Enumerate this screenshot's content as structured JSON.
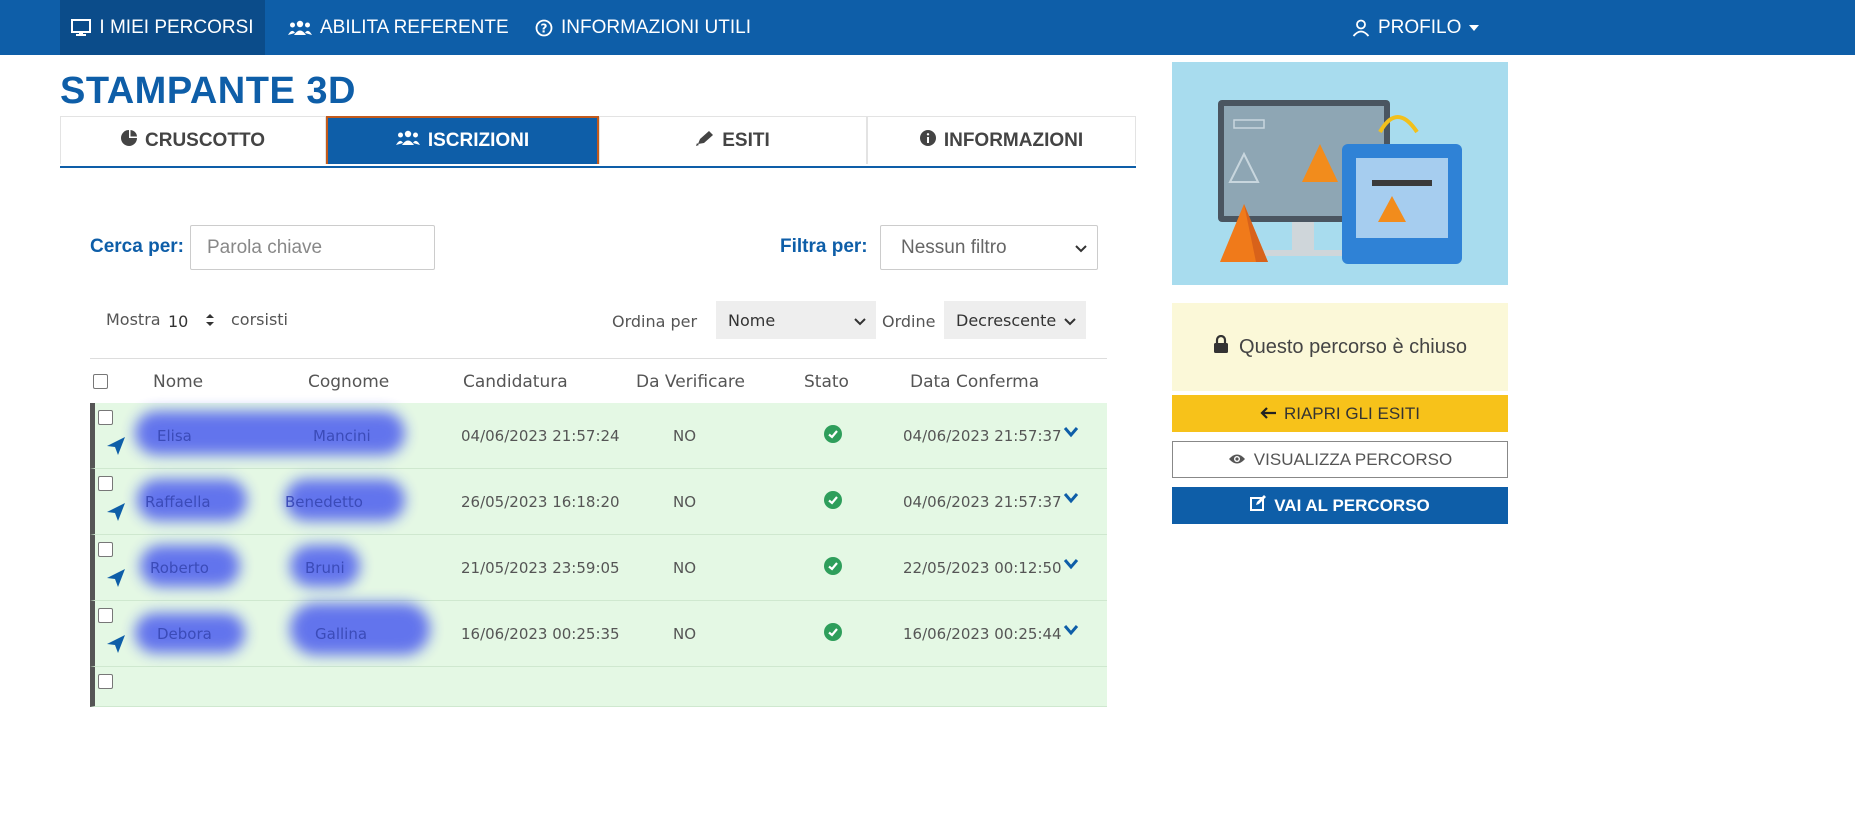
{
  "nav": {
    "items": [
      {
        "label": "I MIEI PERCORSI",
        "icon": "monitor-icon"
      },
      {
        "label": "ABILITA REFERENTE",
        "icon": "users-icon"
      },
      {
        "label": "INFORMAZIONI UTILI",
        "icon": "question-circle-icon"
      }
    ],
    "profile": {
      "label": "PROFILO",
      "icon": "user-icon",
      "caret": "caret-down-icon"
    }
  },
  "page": {
    "title": "STAMPANTE 3D"
  },
  "tabs": [
    {
      "label": "CRUSCOTTO",
      "icon": "pie-chart-icon",
      "active": false
    },
    {
      "label": "ISCRIZIONI",
      "icon": "users-icon",
      "active": true
    },
    {
      "label": "ESITI",
      "icon": "pen-icon",
      "active": false
    },
    {
      "label": "INFORMAZIONI",
      "icon": "info-icon",
      "active": false
    }
  ],
  "search": {
    "label": "Cerca per:",
    "placeholder": "Parola chiave"
  },
  "filter": {
    "label": "Filtra per:",
    "value": "Nessun filtro"
  },
  "list_controls": {
    "show_label": "Mostra",
    "show_value": "10",
    "show_suffix": "corsisti",
    "order_by_label": "Ordina per",
    "order_by_value": "Nome",
    "order_label": "Ordine",
    "order_value": "Decrescente"
  },
  "table": {
    "headers": [
      "Nome",
      "Cognome",
      "Candidatura",
      "Da Verificare",
      "Stato",
      "Data Conferma"
    ],
    "rows": [
      {
        "nome": "Elisa",
        "cognome": "Mancini",
        "candidatura": "04/06/2023 21:57:24",
        "da_verificare": "NO",
        "stato": "confermato",
        "data_conferma": "04/06/2023 21:57:37"
      },
      {
        "nome": "Raffaella",
        "cognome": "Benedetto",
        "candidatura": "26/05/2023 16:18:20",
        "da_verificare": "NO",
        "stato": "confermato",
        "data_conferma": "04/06/2023 21:57:37"
      },
      {
        "nome": "Roberto",
        "cognome": "Bruni",
        "candidatura": "21/05/2023 23:59:05",
        "da_verificare": "NO",
        "stato": "confermato",
        "data_conferma": "22/05/2023 00:12:50"
      },
      {
        "nome": "Debora",
        "cognome": "Gallina",
        "candidatura": "16/06/2023 00:25:35",
        "da_verificare": "NO",
        "stato": "confermato",
        "data_conferma": "16/06/2023 00:25:44"
      }
    ]
  },
  "sidebar": {
    "closed_message": "Questo percorso è chiuso",
    "buttons": {
      "reopen": "RIAPRI GLI ESITI",
      "view": "VISUALIZZA PERCORSO",
      "go": "VAI AL PERCORSO"
    }
  },
  "colors": {
    "primary": "#0e5ea8",
    "accent_yellow": "#f7c21a",
    "row_green": "#e4f8e4",
    "status_green": "#2e9e5b"
  }
}
